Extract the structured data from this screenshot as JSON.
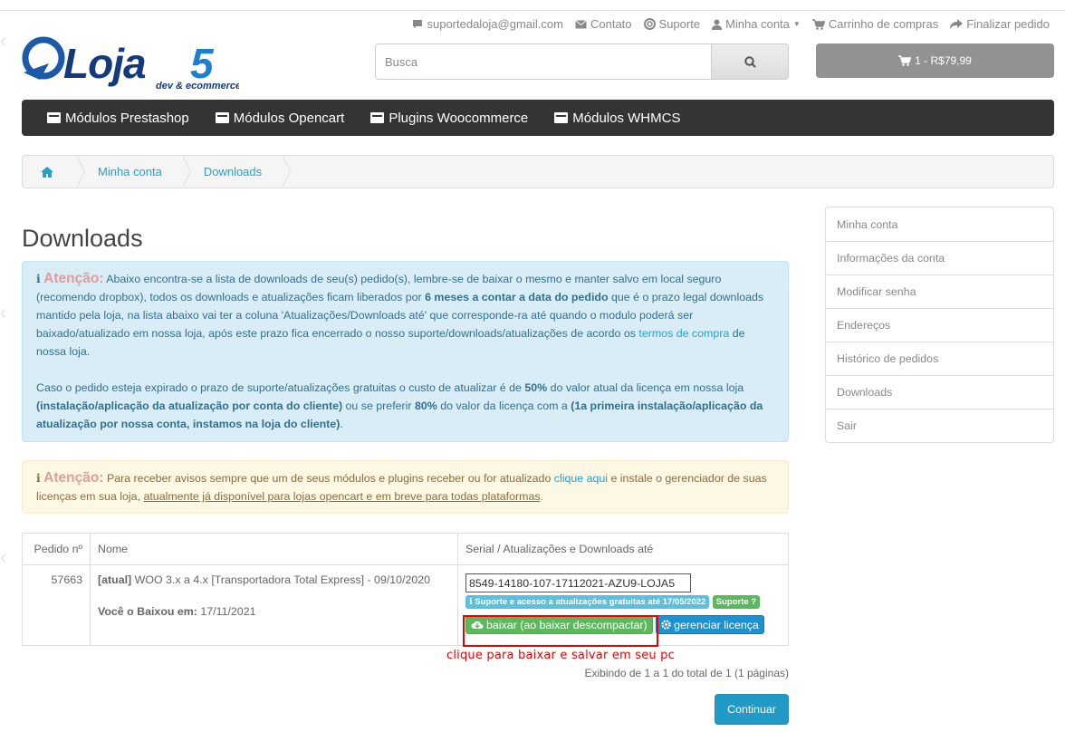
{
  "header": {
    "email": "suportedaloja@gmail.com",
    "contact": "Contato",
    "support": "Suporte",
    "account": "Minha conta",
    "cart": "Carrinho de compras",
    "checkout": "Finalizar pedido"
  },
  "logo": {
    "text": "Loja5",
    "sub": "dev & ecommerce"
  },
  "search": {
    "placeholder": "Busca"
  },
  "cart_button": {
    "label": "1 - R$79,99"
  },
  "menu": [
    "Módulos Prestashop",
    "Módulos Opencart",
    "Plugins Woocommerce",
    "Módulos WHMCS"
  ],
  "breadcrumb": [
    "Minha conta",
    "Downloads"
  ],
  "page_title": "Downloads",
  "alert_info": {
    "title": "Atenção:",
    "p1a": " Abaixo encontra-se a lista de downloads de seu(s) pedido(s), lembre-se de baixar o mesmo e manter salvo em local seguro (recomendo dropbox), todos os downloads e atualizações ficam liberados por ",
    "p1b": "6 meses a contar a data do pedido",
    "p1c": " que é o prazo legal downloads mantido pela loja, na lista abaixo vai ter a coluna 'Atualizações/Downloads até' que corresponde-ra até quando o modulo poderá ser baixado/atualizado em nossa loja, após este prazo fica encerrado o nosso suporte/downloads/atualizações de acordo os ",
    "p1link": "termos de compra",
    "p1d": " de nossa loja.",
    "p2a": "Caso o pedido esteja expirado o prazo de suporte/atualizações gratuitas o custo de atualizar é de ",
    "p2b": "50%",
    "p2c": " do valor atual da licença em nossa loja ",
    "p2d": "(instalação/aplicação da atualização por conta do cliente)",
    "p2e": " ou se preferir ",
    "p2f": "80%",
    "p2g": " do valor da licença com a ",
    "p2h": "(1a primeira instalação/aplicação da atualização por nossa conta, instamos na loja do cliente)",
    "p2i": "."
  },
  "alert_warn": {
    "title": "Atenção:",
    "a": " Para receber avisos sempre que um de seus módulos e plugins receber ou for atualizado ",
    "link": "clique aqui",
    "b": " e instale o gerenciador de suas licenças em sua loja, ",
    "u": "atualmente já disponível para lojas opencart e em breve para todas plataformas",
    "c": "."
  },
  "table": {
    "headers": [
      "Pedido nº",
      "Nome",
      "Serial / Atualizações e Downloads até"
    ],
    "row": {
      "order": "57663",
      "tag": "[atual]",
      "name": " WOO 3.x a 4.x [Transportadora Total Express] - 09/10/2020",
      "downloaded_label": "Você o Baixou em:",
      "downloaded_date": " 17/11/2021",
      "serial": "8549-14180-107-17112021-AZU9-LOJA5",
      "support_label": "Suporte e acesso a atualizações gratuitas até 17/05/2022",
      "support_badge": "Suporte",
      "download_button": "baixar (ao baixar descompactar)",
      "license_button": "gerenciar licença"
    }
  },
  "hint": "clique para baixar e salvar em seu pc",
  "pagination": "Exibindo de 1 a 1 do total de 1 (1 páginas)",
  "continue_button": "Continuar",
  "sidebar": [
    "Minha conta",
    "Informações da conta",
    "Modificar senha",
    "Endereços",
    "Histórico de pedidos",
    "Downloads",
    "Sair"
  ],
  "colors": {
    "accent": "#23a1d1",
    "menu_bg": "#343434",
    "info_bg": "#d9edf7",
    "warn_bg": "#fcf8e3",
    "hint_red": "#e00000"
  }
}
